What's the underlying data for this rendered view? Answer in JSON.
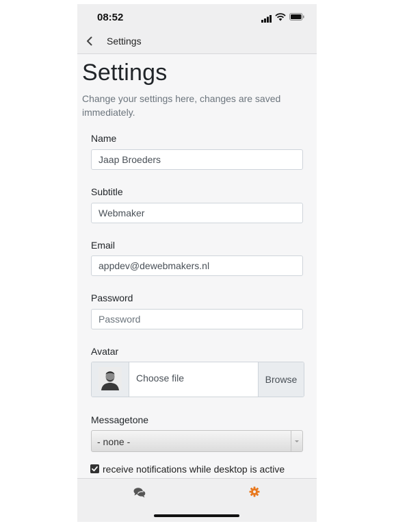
{
  "status_bar": {
    "time": "08:52"
  },
  "nav": {
    "back_icon": "chevron-left-icon",
    "title": "Settings"
  },
  "page": {
    "title": "Settings",
    "description": "Change your settings here, changes are saved immediately."
  },
  "form": {
    "name": {
      "label": "Name",
      "value": "Jaap Broeders"
    },
    "subtitle": {
      "label": "Subtitle",
      "value": "Webmaker"
    },
    "email": {
      "label": "Email",
      "value": "appdev@dewebmakers.nl"
    },
    "password": {
      "label": "Password",
      "placeholder": "Password"
    },
    "avatar": {
      "label": "Avatar",
      "choose_text": "Choose file",
      "browse_label": "Browse"
    },
    "messagetone": {
      "label": "Messagetone",
      "selected": "- none -"
    },
    "notifications": {
      "label": "receive notifications while desktop is active",
      "checked": true
    }
  },
  "tabbar": {
    "tabs": [
      {
        "icon": "chat-bubbles-icon",
        "active": false
      },
      {
        "icon": "gear-icon",
        "active": true
      }
    ],
    "active_color": "#e8781e",
    "inactive_color": "#555555"
  }
}
